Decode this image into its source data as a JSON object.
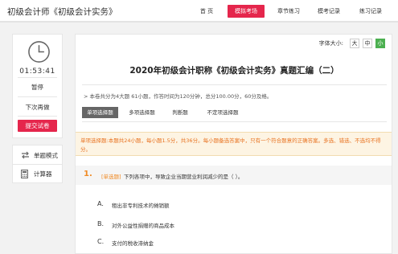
{
  "header": {
    "title": "初级会计师《初级会计实务》",
    "nav": [
      {
        "label": "首 页",
        "active": false
      },
      {
        "label": "模拟考场",
        "active": true
      },
      {
        "label": "章节练习",
        "active": false
      },
      {
        "label": "模考记录",
        "active": false
      },
      {
        "label": "练习记录",
        "active": false
      }
    ]
  },
  "timer": {
    "icon": "clock-icon",
    "time": "01:53:41",
    "pause_label": "暂停",
    "later_label": "下次再做",
    "submit_label": "提交试卷"
  },
  "tools": {
    "single_mode_label": "单题模式",
    "calculator_label": "计算器"
  },
  "font_size": {
    "label": "字体大小:",
    "options": [
      "大",
      "中",
      "小"
    ],
    "selected": "小"
  },
  "paper": {
    "title": "2020年初级会计职称《初级会计实务》真题汇编（二）",
    "info": "> 本卷共分为4大题 61小题，作答时间为120分钟，总分100.00分，60分及格。"
  },
  "tabs": [
    {
      "label": "单项选择题",
      "active": true
    },
    {
      "label": "多项选择题",
      "active": false
    },
    {
      "label": "判断题",
      "active": false
    },
    {
      "label": "不定项选择题",
      "active": false
    }
  ],
  "notice": {
    "line1": "单项选择题:本题共24小题，每小题1.5分，共36分。每小题备选答案中，只有一个符合题意的正确答案。多选、错选、不选均不得",
    "line2": "分。"
  },
  "question": {
    "number": "1.",
    "type": "[单选题]",
    "text": "下列各项中，导致企业当期营业利润减少的是（    ）。",
    "options": [
      {
        "letter": "A.",
        "text": "租出非专利技术的摊销额"
      },
      {
        "letter": "B.",
        "text": "对外公益性捐赠的商品成本"
      },
      {
        "letter": "C.",
        "text": "支付的税收滞纳金"
      }
    ]
  },
  "colors": {
    "accent": "#e5264c",
    "notice_text": "#e87322",
    "question_number": "#f08a24",
    "font_selected": "#4cb050"
  }
}
